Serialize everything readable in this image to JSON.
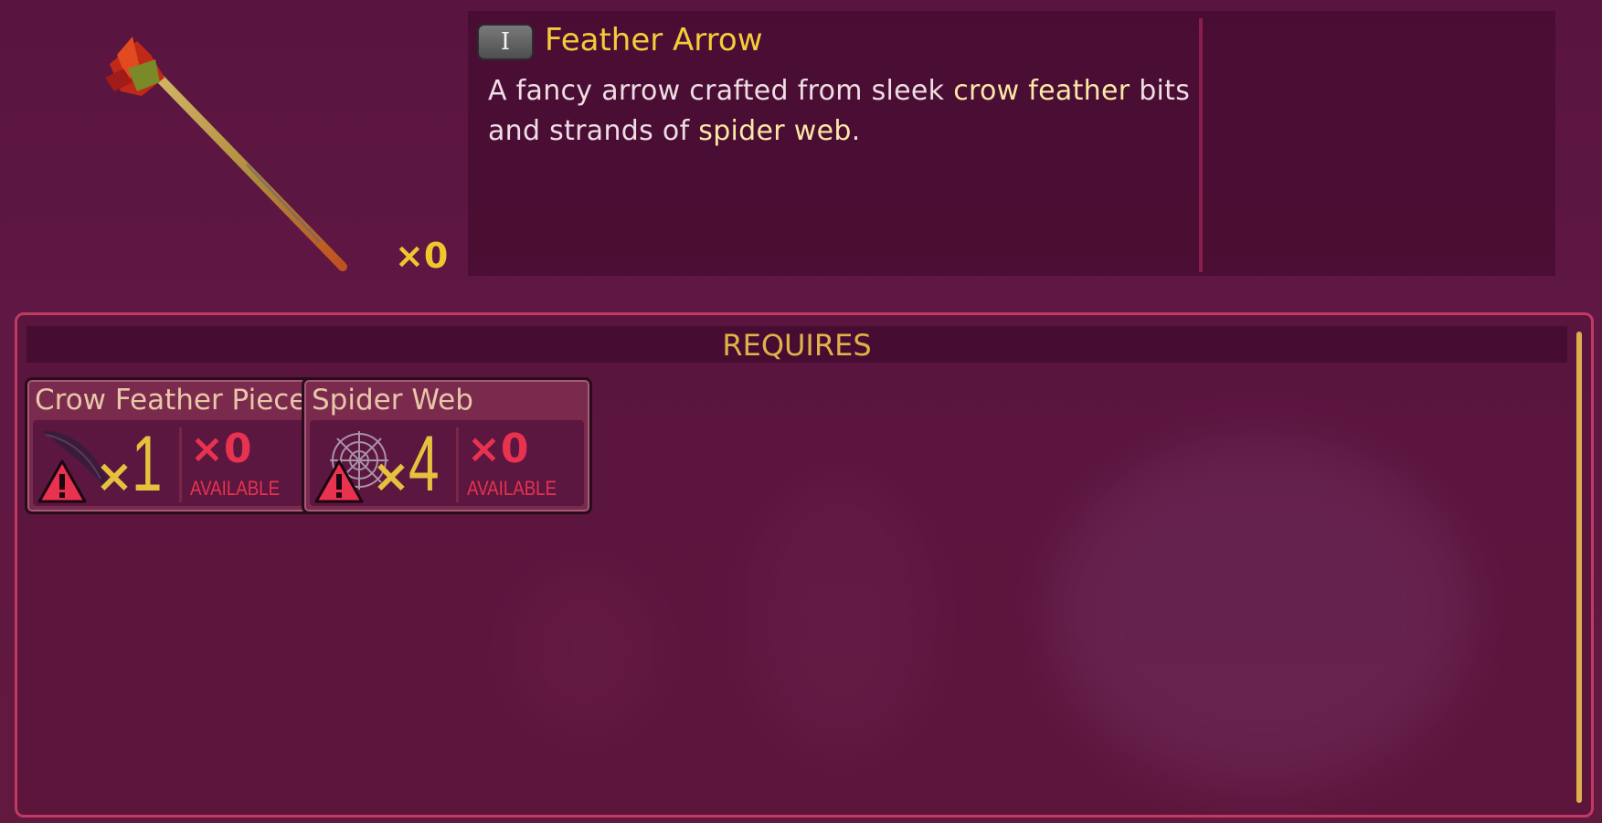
{
  "item": {
    "name": "Feather Arrow",
    "tier": "I",
    "owned": "×0",
    "description": {
      "line1_pre": "A fancy arrow crafted from sleek ",
      "line1_hl": "crow feather",
      "line1_post": " bits",
      "line2_pre": "and strands of ",
      "line2_hl": "spider web",
      "line2_post": "."
    }
  },
  "requires": {
    "title": "REQUIRES",
    "ingredients": [
      {
        "name": "Crow Feather Piece",
        "icon": "crow-feather-icon",
        "times": "×",
        "required": "1",
        "have": "×0",
        "available_label": "AVAILABLE"
      },
      {
        "name": "Spider Web",
        "icon": "spider-web-icon",
        "times": "×",
        "required": "4",
        "have": "×0",
        "available_label": "AVAILABLE"
      }
    ]
  },
  "colors": {
    "accent": "#f4cc3a",
    "warning": "#e8324f",
    "border": "#c13a63"
  }
}
